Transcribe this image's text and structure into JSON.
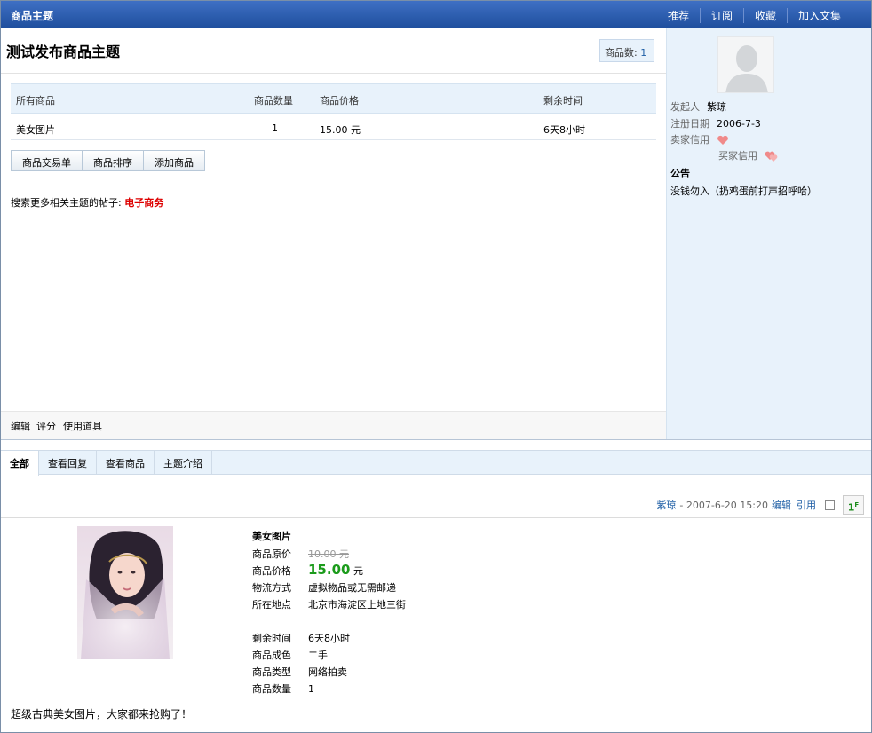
{
  "header": {
    "title": "商品主题",
    "links": [
      "推荐",
      "订阅",
      "收藏",
      "加入文集"
    ]
  },
  "thread": {
    "title": "测试发布商品主题",
    "count_label": "商品数:",
    "count_value": "1"
  },
  "goods_table": {
    "headers": [
      "所有商品",
      "商品数量",
      "商品价格",
      "剩余时间"
    ],
    "rows": [
      {
        "name": "美女图片",
        "qty": "1",
        "price": "15.00 元",
        "remaining": "6天8小时"
      }
    ]
  },
  "buttons": [
    "商品交易单",
    "商品排序",
    "添加商品"
  ],
  "search_more": {
    "label": "搜索更多相关主题的帖子:",
    "keyword": "电子商务"
  },
  "tools": [
    "编辑",
    "评分",
    "使用道具"
  ],
  "sidebar": {
    "initiator_label": "发起人",
    "initiator_value": "紫琼",
    "reg_label": "注册日期",
    "reg_value": "2006-7-3",
    "seller_credit_label": "卖家信用",
    "buyer_credit_label": "买家信用",
    "notice_title": "公告",
    "notice_text": "没钱勿入（扔鸡蛋前打声招呼哈）"
  },
  "tabs": [
    "全部",
    "查看回复",
    "查看商品",
    "主题介绍"
  ],
  "post": {
    "author": "紫琼",
    "datetime": "- 2007-6-20 15:20",
    "edit": "编辑",
    "quote": "引用",
    "floor": "1",
    "floor_sup": "F"
  },
  "product": {
    "name": "美女图片",
    "fields": [
      {
        "label": "商品原价",
        "value": "10.00 元"
      },
      {
        "label": "商品价格",
        "value": "15.00",
        "unit": "元"
      },
      {
        "label": "物流方式",
        "value": "虚拟物品或无需邮递"
      },
      {
        "label": "所在地点",
        "value": "北京市海淀区上地三街"
      },
      {
        "label": "剩余时间",
        "value": "6天8小时"
      },
      {
        "label": "商品成色",
        "value": "二手"
      },
      {
        "label": "商品类型",
        "value": "网络拍卖"
      },
      {
        "label": "商品数量",
        "value": "1"
      }
    ],
    "description": "超级古典美女图片，大家都来抢购了！"
  },
  "colors": {
    "header_bg": "#2a5cb0",
    "panel_bg": "#e8f2fb",
    "price_green": "#1b9b1b",
    "keyword_red": "#dd0000",
    "link_blue": "#1f5fa6"
  }
}
